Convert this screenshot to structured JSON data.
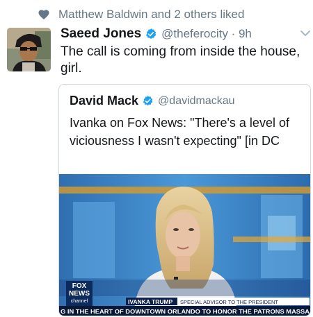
{
  "liked_by": {
    "text": "Matthew Baldwin and 2 others liked",
    "icon": "heart-icon"
  },
  "tweet": {
    "author_name": "Saeed Jones",
    "handle_time": "@theferocity · 9h",
    "text": "The call is coming from inside the house, girl.",
    "icons": [
      "verified-badge-icon",
      "chevron-down-icon"
    ]
  },
  "quote": {
    "author_name": "David Mack",
    "handle": "@davidmackau",
    "text": "Ivanka on Fox News: \"There's a level of viciousness I wasn't expecting\" [in DC",
    "media": {
      "logo_line1": "FOX",
      "logo_line2": "NEWS",
      "logo_line3": "channel",
      "lower_third_name": "IVANKA TRUMP",
      "lower_third_title": "SPECIAL ADVISOR TO THE PRESIDENT",
      "ticker": "G IN THE HEART OF DOWNTOWN ORLANDO TO HONOR THE PATRONS MASSA"
    }
  },
  "colors": {
    "text": "#14171a",
    "secondary": "#657786",
    "verified": "#1da1f2",
    "border": "#cfd9de"
  }
}
